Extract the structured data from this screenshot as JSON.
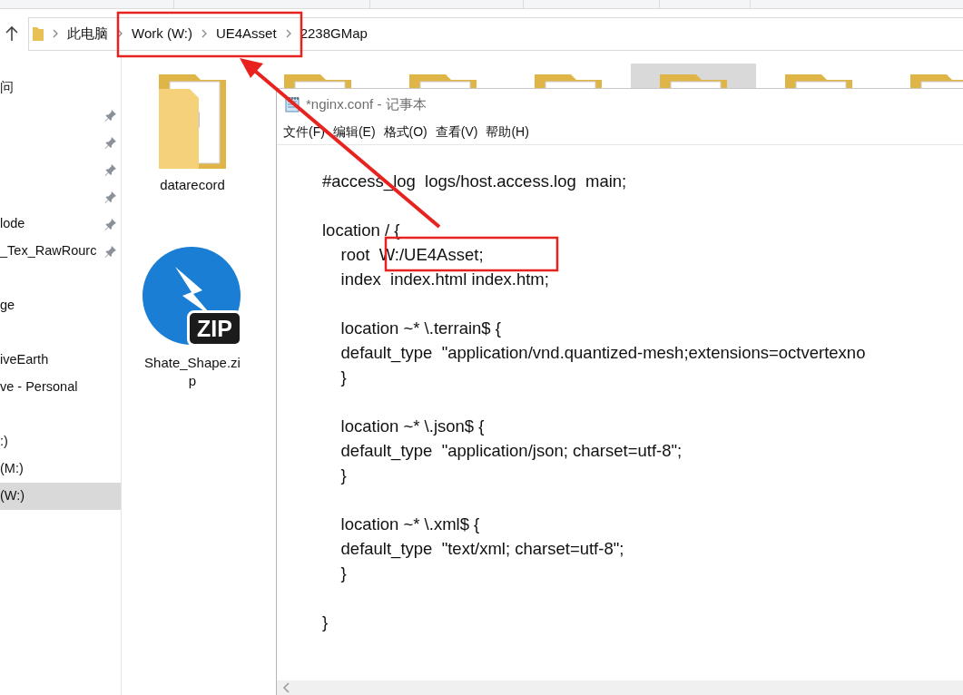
{
  "address_bar": {
    "crumbs": [
      {
        "label": "此电脑"
      },
      {
        "label": "Work (W:)"
      },
      {
        "label": "UE4Asset"
      },
      {
        "label": "2238GMap"
      }
    ]
  },
  "sidebar": {
    "sections": [
      {
        "items": [
          {
            "label": "问",
            "pinned": false,
            "selected": false
          },
          {
            "pinned": true,
            "selected": false
          },
          {
            "pinned": true,
            "selected": false
          },
          {
            "pinned": true,
            "selected": false
          },
          {
            "pinned": true,
            "selected": false
          },
          {
            "label": "lode",
            "pinned": true,
            "selected": false
          },
          {
            "label": "_Tex_RawRourc",
            "pinned": true,
            "selected": false
          }
        ]
      },
      {
        "items": [
          {
            "label": "ge",
            "pinned": false,
            "selected": false
          }
        ]
      },
      {
        "items": [
          {
            "label": "iveEarth",
            "pinned": false,
            "selected": false
          },
          {
            "label": "ve - Personal",
            "pinned": false,
            "selected": false
          }
        ]
      },
      {
        "items": [
          {
            "label": ":)",
            "pinned": false,
            "selected": false
          },
          {
            "label": "(M:)",
            "pinned": false,
            "selected": false
          },
          {
            "label": "(W:)",
            "pinned": false,
            "selected": true
          }
        ]
      }
    ]
  },
  "files": [
    {
      "kind": "folder",
      "name": "datarecord",
      "selected": false
    },
    {
      "kind": "folder",
      "selected": false
    },
    {
      "kind": "folder",
      "selected": false
    },
    {
      "kind": "folder",
      "selected": false
    },
    {
      "kind": "folder",
      "selected": true
    },
    {
      "kind": "folder",
      "selected": false
    },
    {
      "kind": "folder",
      "selected": false
    },
    {
      "kind": "zip",
      "name": "Shate_Shape.zip",
      "badge": "ZIP",
      "selected": false
    }
  ],
  "notepad": {
    "title": "*nginx.conf - 记事本",
    "menu": [
      "文件(F)",
      "编辑(E)",
      "格式(O)",
      "查看(V)",
      "帮助(H)"
    ],
    "blocks": [
      [
        "#access_log  logs/host.access.log  main;"
      ],
      [
        "location / {",
        "    root  W:/UE4Asset;",
        "    index  index.html index.htm;"
      ],
      [
        "    location ~* \\.terrain$ {",
        "    default_type  \"application/vnd.quantized-mesh;extensions=octvertexno",
        "    }"
      ],
      [
        "    location ~* \\.json$ {",
        "    default_type  \"application/json; charset=utf-8\";",
        "    }"
      ],
      [
        "    location ~* \\.xml$ {",
        "    default_type  \"text/xml; charset=utf-8\";",
        "    }"
      ],
      [
        "}"
      ]
    ]
  }
}
